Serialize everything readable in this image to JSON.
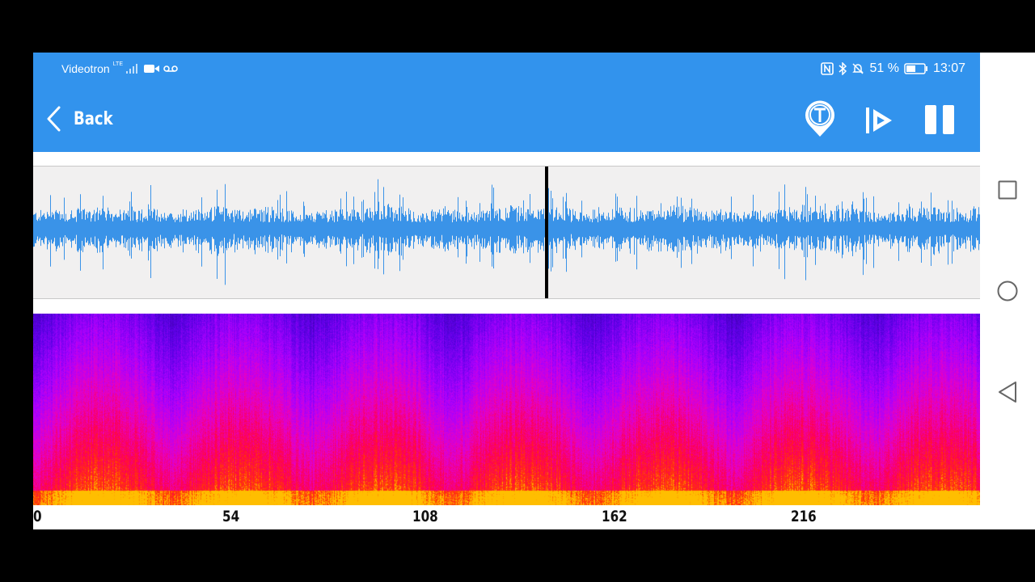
{
  "status_bar": {
    "carrier": "Videotron",
    "network": "LTE",
    "battery_percent": "51 %",
    "time": "13:07"
  },
  "app_bar": {
    "back_label": "Back"
  },
  "colors": {
    "app_bar": "#3293ed",
    "waveform": "#3a93e8",
    "waveform_bg": "#f1f0f0",
    "playhead": "#000000"
  },
  "icons": [
    "chevron-left-icon",
    "tag-t-icon",
    "play-from-start-icon",
    "pause-icon",
    "square-icon",
    "circle-icon",
    "triangle-back-icon"
  ],
  "playback": {
    "playhead_fraction": 0.542
  },
  "time_axis": {
    "ticks": [
      "0",
      "54",
      "108",
      "162",
      "216"
    ]
  }
}
